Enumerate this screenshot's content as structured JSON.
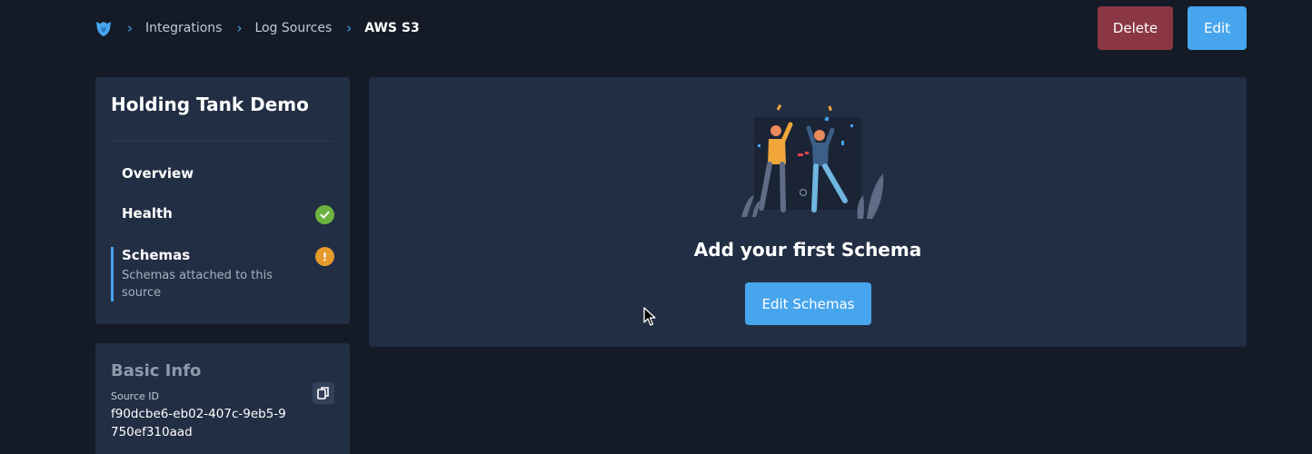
{
  "breadcrumb": {
    "items": [
      "Integrations",
      "Log Sources"
    ],
    "current": "AWS S3"
  },
  "header": {
    "delete_label": "Delete",
    "edit_label": "Edit"
  },
  "source": {
    "name": "Holding Tank Demo"
  },
  "nav": {
    "overview": "Overview",
    "health": "Health",
    "health_status": "ok",
    "schemas": "Schemas",
    "schemas_description": "Schemas attached to this source",
    "schemas_status": "warning"
  },
  "basic_info": {
    "title": "Basic Info",
    "source_id_label": "Source ID",
    "source_id": "f90dcbe6-eb02-407c-9eb5-9750ef310aad"
  },
  "main": {
    "empty_heading": "Add your first Schema",
    "edit_schemas_label": "Edit Schemas"
  },
  "colors": {
    "background": "#141b27",
    "card": "#222e44",
    "accent": "#47a5ee",
    "danger": "#8b3644",
    "success": "#6cb33f",
    "warning": "#e59b2b"
  }
}
